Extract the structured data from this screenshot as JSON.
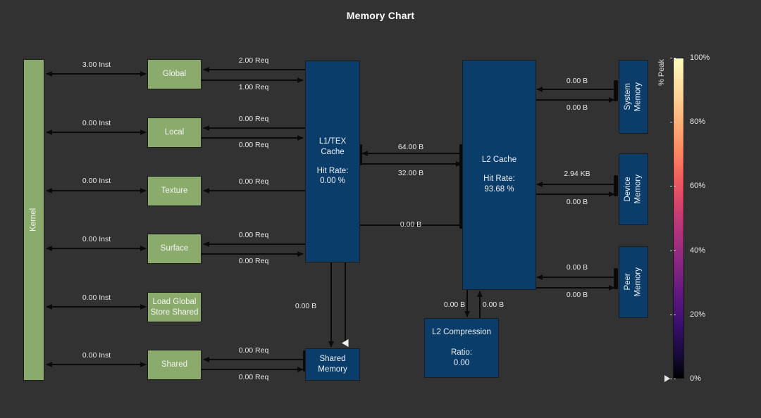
{
  "chart_data": {
    "type": "diagram",
    "title": "Memory Chart",
    "legend": {
      "axis_title": "% Peak",
      "ticks": [
        "100%",
        "80%",
        "60%",
        "40%",
        "20%",
        "0%"
      ],
      "tick_values": [
        100,
        80,
        60,
        40,
        20,
        0
      ],
      "colormap": "inferno",
      "marker_value": 0
    },
    "units_nodes": [
      {
        "id": "kernel",
        "label": "Kernel",
        "kind": "green",
        "orientation": "vertical"
      },
      {
        "id": "global",
        "label": "Global",
        "kind": "green"
      },
      {
        "id": "local",
        "label": "Local",
        "kind": "green"
      },
      {
        "id": "texture",
        "label": "Texture",
        "kind": "green"
      },
      {
        "id": "surface",
        "label": "Surface",
        "kind": "green"
      },
      {
        "id": "load-global-store-shared",
        "label": "Load Global\nStore Shared",
        "kind": "green"
      },
      {
        "id": "shared",
        "label": "Shared",
        "kind": "green"
      },
      {
        "id": "l1tex-cache",
        "label": "L1/TEX\nCache",
        "metric_label": "Hit Rate:",
        "metric_value": "0.00 %",
        "kind": "blue"
      },
      {
        "id": "l2-cache",
        "label": "L2 Cache",
        "metric_label": "Hit Rate:",
        "metric_value": "93.68 %",
        "kind": "blue"
      },
      {
        "id": "shared-memory",
        "label": "Shared\nMemory",
        "kind": "blue"
      },
      {
        "id": "l2-compression",
        "label": "L2 Compression",
        "metric_label": "Ratio:",
        "metric_value": "0.00",
        "kind": "blue"
      },
      {
        "id": "system-memory",
        "label": "System\nMemory",
        "kind": "blue",
        "orientation": "vertical"
      },
      {
        "id": "device-memory",
        "label": "Device\nMemory",
        "kind": "blue",
        "orientation": "vertical"
      },
      {
        "id": "peer-memory",
        "label": "Peer\nMemory",
        "kind": "blue",
        "orientation": "vertical"
      }
    ],
    "edges": [
      {
        "from": "kernel",
        "to": "global",
        "value": "3.00 Inst"
      },
      {
        "from": "kernel",
        "to": "local",
        "value": "0.00 Inst"
      },
      {
        "from": "kernel",
        "to": "texture",
        "value": "0.00 Inst"
      },
      {
        "from": "kernel",
        "to": "surface",
        "value": "0.00 Inst"
      },
      {
        "from": "kernel",
        "to": "load-global-store-shared",
        "value": "0.00 Inst"
      },
      {
        "from": "kernel",
        "to": "shared",
        "value": "0.00 Inst"
      },
      {
        "from": "l1tex-cache",
        "to": "global",
        "value": "2.00 Req"
      },
      {
        "from": "global",
        "to": "l1tex-cache",
        "value": "1.00 Req"
      },
      {
        "from": "l1tex-cache",
        "to": "local",
        "value": "0.00 Req"
      },
      {
        "from": "local",
        "to": "l1tex-cache",
        "value": "0.00 Req"
      },
      {
        "from": "l1tex-cache",
        "to": "texture",
        "value": "0.00 Req"
      },
      {
        "from": "l1tex-cache",
        "to": "surface",
        "value": "0.00 Req"
      },
      {
        "from": "surface",
        "to": "l1tex-cache",
        "value": "0.00 Req"
      },
      {
        "from": "shared-memory",
        "to": "shared",
        "value": "0.00 Req"
      },
      {
        "from": "shared",
        "to": "shared-memory",
        "value": "0.00 Req"
      },
      {
        "from": "l2-cache",
        "to": "l1tex-cache",
        "value": "64.00 B"
      },
      {
        "from": "l1tex-cache",
        "to": "l2-cache",
        "value": "32.00 B"
      },
      {
        "from": "l1tex-cache",
        "to": "shared-memory",
        "value": "0.00 B"
      },
      {
        "from": "shared-memory",
        "to": "l2-cache",
        "value": "0.00 B"
      },
      {
        "from": "system-memory",
        "to": "l2-cache",
        "value": "0.00 B"
      },
      {
        "from": "l2-cache",
        "to": "system-memory",
        "value": "0.00 B"
      },
      {
        "from": "device-memory",
        "to": "l2-cache",
        "value": "2.94 KB"
      },
      {
        "from": "l2-cache",
        "to": "device-memory",
        "value": "0.00 B"
      },
      {
        "from": "peer-memory",
        "to": "l2-cache",
        "value": "0.00 B"
      },
      {
        "from": "l2-cache",
        "to": "peer-memory",
        "value": "0.00 B"
      },
      {
        "from": "l2-cache",
        "to": "l2-compression",
        "value": "0.00 B"
      },
      {
        "from": "l2-compression",
        "to": "l2-cache",
        "value": "0.00 B"
      }
    ]
  },
  "title": "Memory Chart",
  "nodes": {
    "kernel": "Kernel",
    "global": "Global",
    "local": "Local",
    "texture": "Texture",
    "surface": "Surface",
    "lgss_line1": "Load Global",
    "lgss_line2": "Store Shared",
    "shared": "Shared",
    "l1tex_line1": "L1/TEX",
    "l1tex_line2": "Cache",
    "l1tex_hit_label": "Hit Rate:",
    "l1tex_hit_value": "0.00 %",
    "l2_label": "L2 Cache",
    "l2_hit_label": "Hit Rate:",
    "l2_hit_value": "93.68 %",
    "shared_mem_line1": "Shared",
    "shared_mem_line2": "Memory",
    "l2_compression": "L2 Compression",
    "l2_ratio_label": "Ratio:",
    "l2_ratio_value": "0.00",
    "system_memory_line1": "System",
    "system_memory_line2": "Memory",
    "device_memory_line1": "Device",
    "device_memory_line2": "Memory",
    "peer_memory_line1": "Peer",
    "peer_memory_line2": "Memory"
  },
  "labels": {
    "kernel_global": "3.00 Inst",
    "kernel_local": "0.00 Inst",
    "kernel_texture": "0.00 Inst",
    "kernel_surface": "0.00 Inst",
    "kernel_lgss": "0.00 Inst",
    "kernel_shared": "0.00 Inst",
    "global_in": "2.00 Req",
    "global_out": "1.00 Req",
    "local_in": "0.00 Req",
    "local_out": "0.00 Req",
    "texture_in": "0.00 Req",
    "surface_in": "0.00 Req",
    "surface_out": "0.00 Req",
    "shared_in": "0.00 Req",
    "shared_out": "0.00 Req",
    "l1_l2_up": "64.00 B",
    "l1_l2_down": "32.00 B",
    "l1_shared": "0.00 B",
    "sharedmem_l2": "0.00 B",
    "sysmem_in": "0.00 B",
    "sysmem_out": "0.00 B",
    "devmem_in": "2.94 KB",
    "devmem_out": "0.00 B",
    "peermem_in": "0.00 B",
    "peermem_out": "0.00 B",
    "l2comp_down": "0.00 B",
    "l2comp_up": "0.00 B"
  },
  "colorbar": {
    "axis_title": "% Peak",
    "tick_100": "100%",
    "tick_80": "80%",
    "tick_60": "60%",
    "tick_40": "40%",
    "tick_20": "20%",
    "tick_0": "0%"
  },
  "colors": {
    "background": "#323232",
    "green_node": "#8aab6b",
    "blue_node": "#0b3d6b",
    "edge": "#0a0a0a",
    "text": "#f2f2f2"
  }
}
